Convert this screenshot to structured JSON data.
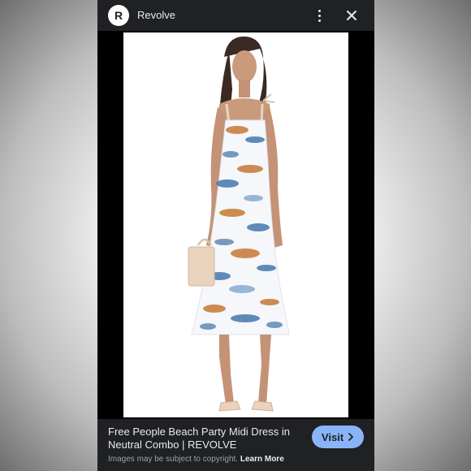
{
  "header": {
    "logo_letter": "R",
    "site_name": "Revolve",
    "more_icon": "more-vert-icon",
    "close_icon": "close-icon"
  },
  "image": {
    "alt": "Free People Beach Party Midi Dress in Neutral Combo",
    "colors": {
      "background": "#ffffff",
      "print_blue": "#4f7fb0",
      "print_orange": "#c9803f",
      "bag": "#e9d3bd"
    }
  },
  "caption": {
    "title": "Free People Beach Party Midi Dress in Neutral Combo | REVOLVE",
    "disclaimer": "Images may be subject to copyright.",
    "learn_more": "Learn More",
    "visit_label": "Visit",
    "visit_icon": "chevron-right-icon"
  },
  "theme": {
    "panel_bg": "#202124",
    "accent": "#8ab4f8",
    "text": "#e8eaed",
    "muted": "#9aa0a6"
  }
}
